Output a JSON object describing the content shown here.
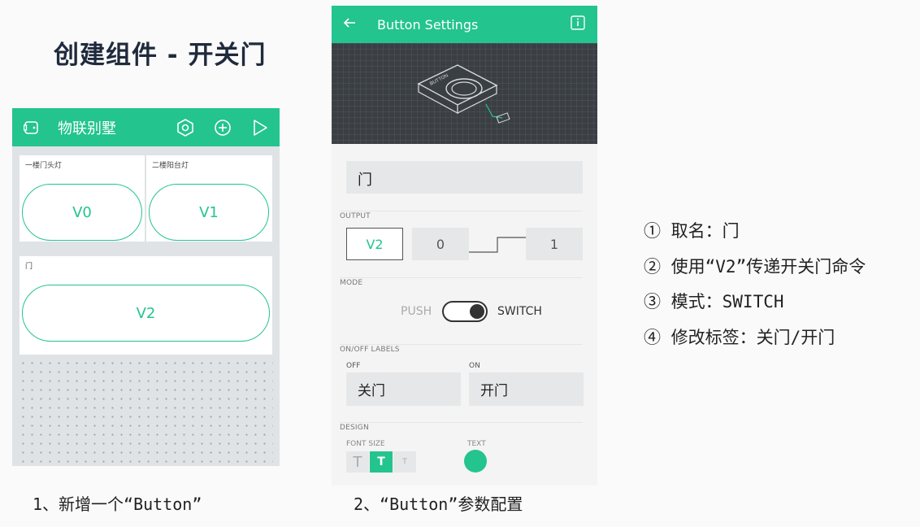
{
  "slide_title": "创建组件 - 开关门",
  "phone1": {
    "app_title": "物联别墅",
    "widgets": [
      {
        "label": "一楼门头灯",
        "button": "V0"
      },
      {
        "label": "二楼阳台灯",
        "button": "V1"
      },
      {
        "label": "门",
        "button": "V2"
      }
    ],
    "caption": "1、新增一个“Button”"
  },
  "phone2": {
    "screen_title": "Button Settings",
    "name_value": "门",
    "output_label": "OUTPUT",
    "output_pin": "V2",
    "output_low": "0",
    "output_high": "1",
    "mode_label": "MODE",
    "mode_push": "PUSH",
    "mode_switch": "SWITCH",
    "onoff_label": "ON/OFF LABELS",
    "off_label": "OFF",
    "on_label": "ON",
    "off_value": "关门",
    "on_value": "开门",
    "design_label": "DESIGN",
    "font_size_label": "FONT SIZE",
    "font_sizes": [
      "T",
      "T",
      "T"
    ],
    "text_color_label": "TEXT",
    "hero_device_text": "BUTTON",
    "caption": "2、“Button”参数配置"
  },
  "notes": [
    "① 取名：门",
    "② 使用“V2”传递开关门命令",
    "③ 模式：SWITCH",
    "④ 修改标签：关门/开门"
  ],
  "colors": {
    "accent": "#23c48e",
    "dark": "#3a3f44"
  }
}
